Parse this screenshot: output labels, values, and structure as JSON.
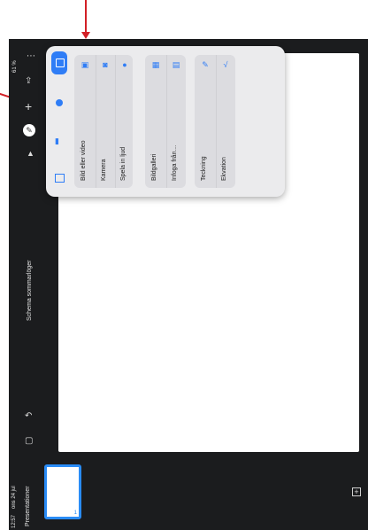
{
  "status_bar": {
    "time": "12:57",
    "date": "ons 24 jul",
    "battery": "61 %"
  },
  "toolbar": {
    "presentations_label": "Presentationer",
    "doc_title": "Schema sommarlöger"
  },
  "insert_popover": {
    "group1": [
      {
        "label": "Bild eller video",
        "icon": "photo-icon"
      },
      {
        "label": "Kamera",
        "icon": "camera-icon"
      },
      {
        "label": "Spela in ljud",
        "icon": "microphone-icon"
      }
    ],
    "group2": [
      {
        "label": "Bildgalleri",
        "icon": "gallery-icon"
      },
      {
        "label": "Infoga från…",
        "icon": "insert-from-icon"
      }
    ],
    "group3": [
      {
        "label": "Teckning",
        "icon": "drawing-icon"
      },
      {
        "label": "Ekvation",
        "icon": "equation-icon"
      }
    ]
  },
  "slide_thumbnails": [
    {
      "number": "1"
    }
  ],
  "colors": {
    "accent": "#2f7df6",
    "annotation_arrow": "#d21f26",
    "dark_bg": "#1b1c1e"
  }
}
